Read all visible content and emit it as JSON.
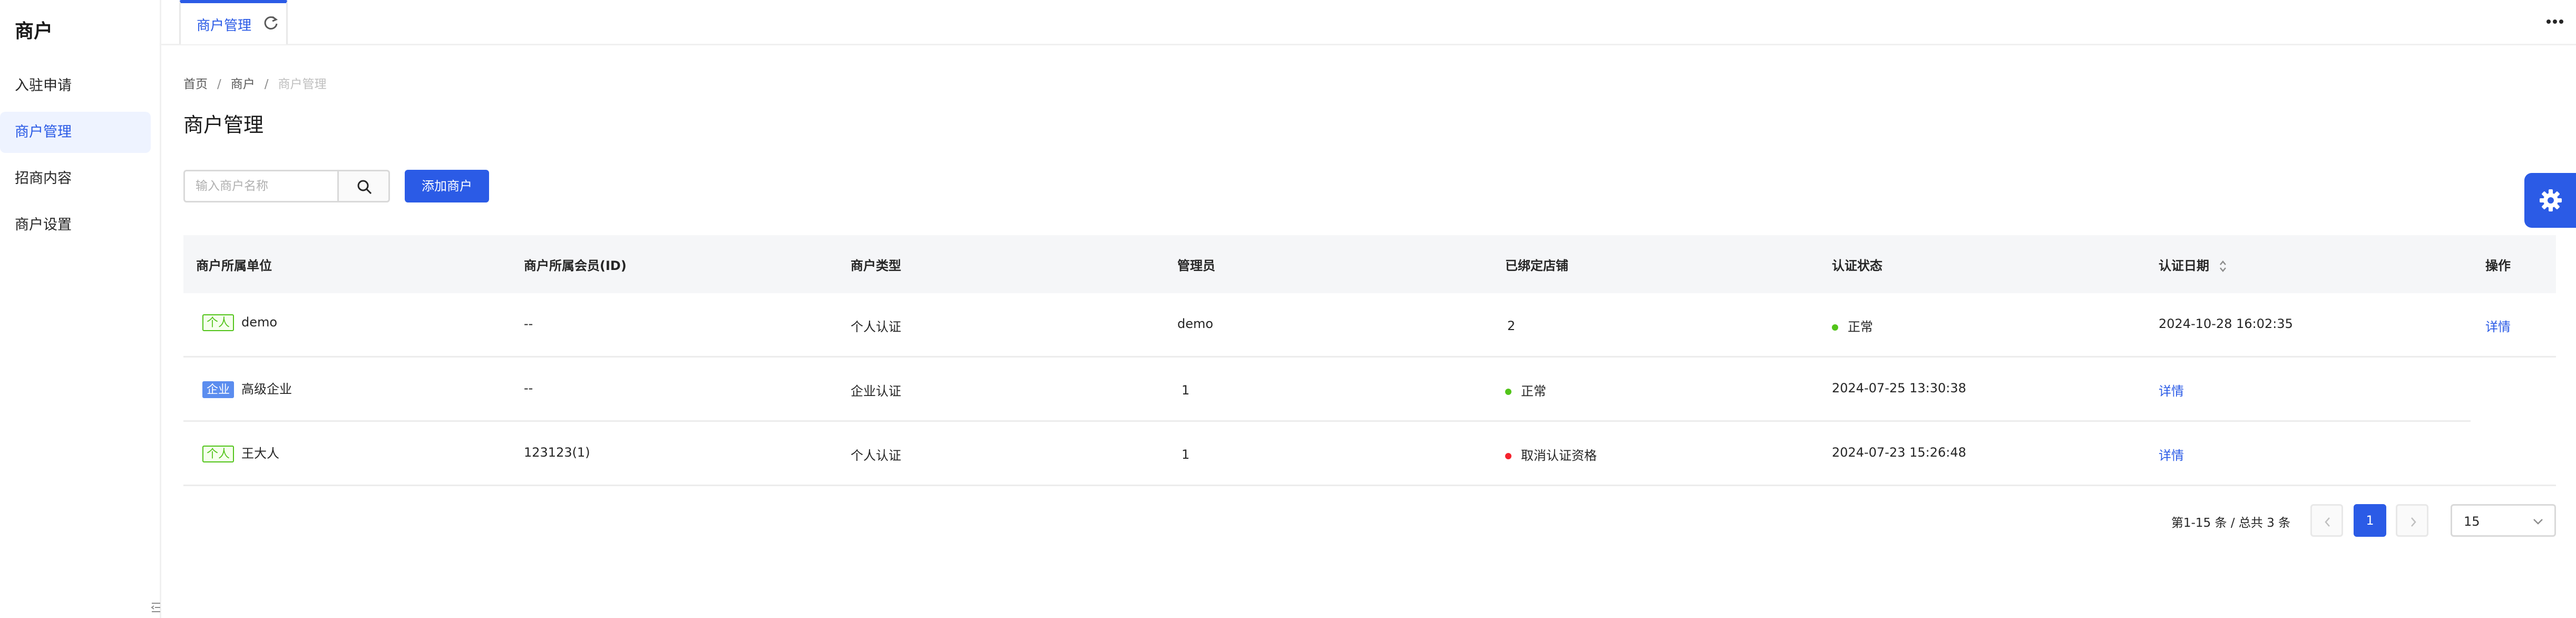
{
  "sidebar": {
    "title": "商户",
    "items": [
      {
        "label": "入驻申请"
      },
      {
        "label": "商户管理"
      },
      {
        "label": "招商内容"
      },
      {
        "label": "商户设置"
      }
    ]
  },
  "tabs": [
    {
      "label": "商户管理"
    }
  ],
  "breadcrumb": {
    "items": [
      "首页",
      "商户",
      "商户管理"
    ],
    "separator": "/"
  },
  "page": {
    "title": "商户管理"
  },
  "toolbar": {
    "search_placeholder": "输入商户名称",
    "add_label": "添加商户"
  },
  "table": {
    "columns": [
      "商户所属单位",
      "商户所属会员(ID)",
      "商户类型",
      "管理员",
      "已绑定店铺",
      "认证状态",
      "认证日期",
      "操作"
    ],
    "rows": [
      {
        "tag": "个人",
        "name": "demo",
        "member": "--",
        "type": "个人认证",
        "admin": "demo",
        "stores": "2",
        "status": "正常",
        "date": "2024-10-28 16:02:35",
        "action": "详情"
      },
      {
        "tag": "企业",
        "name": "高级企业",
        "member": "--",
        "type": "企业认证",
        "admin": "",
        "stores": "1",
        "status": "正常",
        "date": "2024-07-25 13:30:38",
        "action": "详情"
      },
      {
        "tag": "个人",
        "name": "王大人",
        "member": "123123(1)",
        "type": "个人认证",
        "admin": "",
        "stores": "1",
        "status": "取消认证资格",
        "date": "2024-07-23 15:26:48",
        "action": "详情"
      }
    ]
  },
  "pagination": {
    "summary": "第1-15 条 / 总共 3 条",
    "current_page": "1",
    "page_size": "15"
  },
  "colors": {
    "primary": "#2b5be6",
    "status_ok": "#52c41a",
    "status_revoked": "#f5222d"
  },
  "icons": {
    "refresh": "refresh-icon",
    "more": "more-icon",
    "search": "search-icon",
    "sort": "sort-icon",
    "settings": "gear-icon"
  }
}
